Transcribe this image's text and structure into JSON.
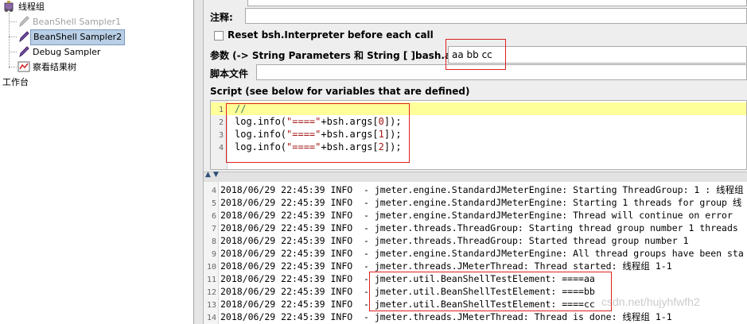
{
  "tree": {
    "root": "线程组",
    "items": [
      {
        "label": "BeanShell Sampler1",
        "state": "disabled"
      },
      {
        "label": "BeanShell Sampler2",
        "state": "selected"
      },
      {
        "label": "Debug Sampler",
        "state": "normal"
      },
      {
        "label": "察看结果树",
        "state": "normal"
      }
    ],
    "workbench": "工作台"
  },
  "form": {
    "comment_label": "注释:",
    "reset_label": "Reset bsh.Interpreter before each call",
    "params_label": "参数 (-> String Parameters 和 String [ ]bash.args)",
    "params_value": "aa bb cc",
    "script_file_label": "脚本文件",
    "script_label": "Script (see below for variables that are defined)"
  },
  "script": {
    "lines": [
      {
        "n": "1",
        "parts": [
          {
            "t": "//",
            "c": "cm"
          }
        ]
      },
      {
        "n": "2",
        "parts": [
          {
            "t": "log.info(",
            "c": ""
          },
          {
            "t": "\"====\"",
            "c": "str"
          },
          {
            "t": "+bsh.args[",
            "c": ""
          },
          {
            "t": "0",
            "c": "str"
          },
          {
            "t": "]);",
            "c": ""
          }
        ]
      },
      {
        "n": "3",
        "parts": [
          {
            "t": "log.info(",
            "c": ""
          },
          {
            "t": "\"====\"",
            "c": "str"
          },
          {
            "t": "+bsh.args[",
            "c": ""
          },
          {
            "t": "1",
            "c": "str"
          },
          {
            "t": "]);",
            "c": ""
          }
        ]
      },
      {
        "n": "4",
        "parts": [
          {
            "t": "log.info(",
            "c": ""
          },
          {
            "t": "\"====\"",
            "c": "str"
          },
          {
            "t": "+bsh.args[",
            "c": ""
          },
          {
            "t": "2",
            "c": "str"
          },
          {
            "t": "]);",
            "c": ""
          }
        ]
      }
    ]
  },
  "log": {
    "lines": [
      {
        "n": "4",
        "text": "2018/06/29 22:45:39 INFO  - jmeter.engine.StandardJMeterEngine: Starting ThreadGroup: 1 : 线程组"
      },
      {
        "n": "5",
        "text": "2018/06/29 22:45:39 INFO  - jmeter.engine.StandardJMeterEngine: Starting 1 threads for group 线"
      },
      {
        "n": "6",
        "text": "2018/06/29 22:45:39 INFO  - jmeter.engine.StandardJMeterEngine: Thread will continue on error"
      },
      {
        "n": "7",
        "text": "2018/06/29 22:45:39 INFO  - jmeter.threads.ThreadGroup: Starting thread group number 1 threads"
      },
      {
        "n": "8",
        "text": "2018/06/29 22:45:39 INFO  - jmeter.threads.ThreadGroup: Started thread group number 1"
      },
      {
        "n": "9",
        "text": "2018/06/29 22:45:39 INFO  - jmeter.engine.StandardJMeterEngine: All thread groups have been sta"
      },
      {
        "n": "10",
        "text": "2018/06/29 22:45:39 INFO  - jmeter.threads.JMeterThread: Thread started: 线程组 1-1"
      },
      {
        "n": "11",
        "text": "2018/06/29 22:45:39 INFO  - jmeter.util.BeanShellTestElement: ====aa"
      },
      {
        "n": "12",
        "text": "2018/06/29 22:45:39 INFO  - jmeter.util.BeanShellTestElement: ====bb"
      },
      {
        "n": "13",
        "text": "2018/06/29 22:45:39 INFO  - jmeter.util.BeanShellTestElement: ====cc"
      },
      {
        "n": "14",
        "text": "2018/06/29 22:45:39 INFO  - jmeter.threads.JMeterThread: Thread is done: 线程组 1-1"
      }
    ]
  },
  "watermark": "csdn.net/hujyhfwfh2"
}
